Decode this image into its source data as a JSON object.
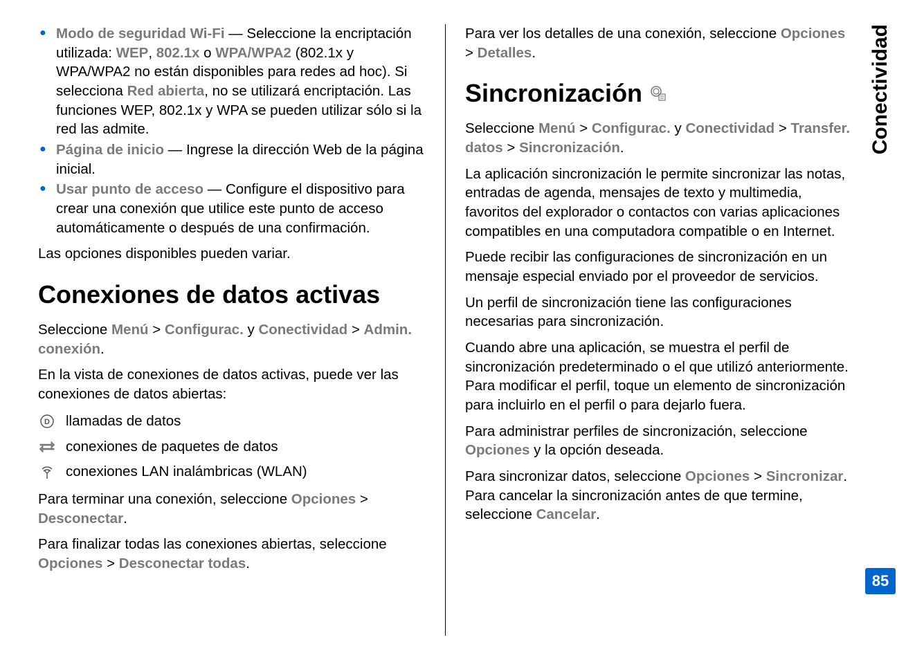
{
  "sidebar": {
    "section": "Conectividad",
    "page": "85"
  },
  "left": {
    "bullets": [
      {
        "term": "Modo de seguridad Wi-Fi",
        "dash": " — Seleccione la encriptación utilizada: ",
        "opt1": "WEP",
        "sep1": ", ",
        "opt2": "802.1x",
        "sep2": " o ",
        "opt3": "WPA/WPA2",
        "after": " (802.1x y WPA/WPA2 no están disponibles para redes ad hoc). Si selecciona ",
        "opt4": "Red abierta",
        "after2": ", no se utilizará encriptación. Las funciones WEP, 802.1x y WPA se pueden utilizar sólo si la red las admite."
      },
      {
        "term": "Página de inicio",
        "dash": " — Ingrese la dirección Web de la página inicial."
      },
      {
        "term": "Usar punto de acceso",
        "dash": " — Configure el dispositivo para crear una conexión que utilice este punto de acceso automáticamente o después de una confirmación."
      }
    ],
    "vary": "Las opciones disponibles pueden variar.",
    "h1": "Conexiones de datos activas",
    "nav1_a": "Seleccione ",
    "nav1_menu": "Menú",
    "nav1_gt1": " > ",
    "nav1_config": "Configurac.",
    "nav1_y": " y ",
    "nav1_conn": "Conectividad",
    "nav1_gt2": " > ",
    "nav1_admin": "Admin. conexión",
    "nav1_dot": ".",
    "intro": "En la vista de conexiones de datos activas, puede ver las conexiones de datos abiertas:",
    "icons": [
      {
        "label": "llamadas de datos"
      },
      {
        "label": "conexiones de paquetes de datos"
      },
      {
        "label": "conexiones LAN inalámbricas (WLAN)"
      }
    ],
    "term1_a": "Para terminar una conexión, seleccione ",
    "term1_opc": "Opciones",
    "term1_gt": " > ",
    "term1_desc": "Desconectar",
    "term1_dot": ".",
    "term2_a": "Para finalizar todas las conexiones abiertas, seleccione ",
    "term2_opc": "Opciones",
    "term2_gt": " > ",
    "term2_desc": "Desconectar todas",
    "term2_dot": "."
  },
  "right": {
    "detail_a": "Para ver los detalles de una conexión, seleccione ",
    "detail_opc": "Opciones",
    "detail_gt": " > ",
    "detail_det": "Detalles",
    "detail_dot": ".",
    "h1": "Sincronización",
    "nav_a": "Seleccione ",
    "nav_menu": "Menú",
    "nav_gt1": " > ",
    "nav_config": "Configurac.",
    "nav_y": " y ",
    "nav_conn": "Conectividad",
    "nav_gt2": " > ",
    "nav_trans": "Transfer. datos",
    "nav_gt3": " > ",
    "nav_sync": "Sincronización",
    "nav_dot": ".",
    "p1": "La aplicación sincronización le permite sincronizar las notas, entradas de agenda, mensajes de texto y multimedia, favoritos del explorador o contactos con varias aplicaciones compatibles en una computadora compatible o en Internet.",
    "p2": "Puede recibir las configuraciones de sincronización en un mensaje especial enviado por el proveedor de servicios.",
    "p3": "Un perfil de sincronización tiene las configuraciones necesarias para sincronización.",
    "p4": "Cuando abre una aplicación, se muestra el perfil de sincronización predeterminado o el que utilizó anteriormente. Para modificar el perfil, toque un elemento de sincronización para incluirlo en el perfil o para dejarlo fuera.",
    "p5_a": "Para administrar perfiles de sincronización, seleccione ",
    "p5_opc": "Opciones",
    "p5_b": " y la opción deseada.",
    "p6_a": "Para sincronizar datos, seleccione ",
    "p6_opc": "Opciones",
    "p6_gt": " > ",
    "p6_sync": "Sincronizar",
    "p6_b": ". Para cancelar la sincronización antes de que termine, seleccione ",
    "p6_cancel": "Cancelar",
    "p6_dot": "."
  }
}
